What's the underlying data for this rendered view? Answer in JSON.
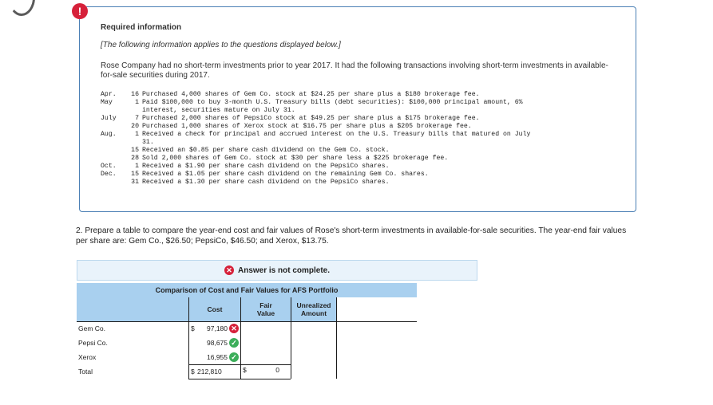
{
  "alert_glyph": "!",
  "info": {
    "title": "Required information",
    "subtitle": "[The following information applies to the questions displayed below.]",
    "intro": "Rose Company had no short-term investments prior to year 2017. It had the following transactions involving short-term investments in available-for-sale securities during 2017.",
    "transactions": [
      {
        "month": "Apr.",
        "day": "16",
        "text": "Purchased 4,000 shares of Gem Co. stock at $24.25 per share plus a $180 brokerage fee."
      },
      {
        "month": "May",
        "day": "1",
        "text": "Paid $100,000 to buy 3-month U.S. Treasury bills (debt securities): $100,000 principal amount, 6%\ninterest, securities mature on July 31."
      },
      {
        "month": "July",
        "day": "7",
        "text": "Purchased 2,000 shares of PepsiCo stock at $49.25 per share plus a $175 brokerage fee."
      },
      {
        "month": "",
        "day": "20",
        "text": "Purchased 1,000 shares of Xerox stock at $16.75 per share plus a $205 brokerage fee."
      },
      {
        "month": "Aug.",
        "day": "1",
        "text": "Received a check for principal and accrued interest on the U.S. Treasury bills that matured on July\n31."
      },
      {
        "month": "",
        "day": "15",
        "text": "Received an $0.85 per share cash dividend on the Gem Co. stock."
      },
      {
        "month": "",
        "day": "28",
        "text": "Sold 2,000 shares of Gem Co. stock at $30 per share less a $225 brokerage fee."
      },
      {
        "month": "Oct.",
        "day": "1",
        "text": "Received a $1.90 per share cash dividend on the PepsiCo shares."
      },
      {
        "month": "Dec.",
        "day": "15",
        "text": "Received a $1.05 per share cash dividend on the remaining Gem Co. shares."
      },
      {
        "month": "",
        "day": "31",
        "text": "Received a $1.30 per share cash dividend on the PepsiCo shares."
      }
    ]
  },
  "question": "2. Prepare a table to compare the year-end cost and fair values of Rose's short-term investments in available-for-sale securities. The year-end fair values per share are: Gem Co., $26.50; PepsiCo, $46.50; and Xerox, $13.75.",
  "answer_banner": {
    "text": "Answer is not complete.",
    "x_glyph": "✕"
  },
  "table": {
    "title": "Comparison of Cost and Fair Values for AFS Portfolio",
    "col_cost": "Cost",
    "col_fair": "Fair\nValue",
    "col_unrealized": "Unrealized\nAmount",
    "rows": [
      {
        "label": "Gem Co.",
        "cost_prefix": "$",
        "cost": "97,180",
        "status": "incorrect"
      },
      {
        "label": "Pepsi Co.",
        "cost_prefix": "",
        "cost": "98,675",
        "status": "correct"
      },
      {
        "label": "Xerox",
        "cost_prefix": "",
        "cost": "16,955",
        "status": "correct"
      }
    ],
    "total": {
      "label": "Total",
      "cost_prefix": "$",
      "cost": "212,810",
      "fair_prefix": "$",
      "fair": "0"
    },
    "incorrect_glyph": "✕",
    "correct_glyph": "✓"
  },
  "colors": {
    "accent_border": "#4b80b5",
    "header_fill": "#a9d0ef",
    "banner_fill": "#e9f3fb",
    "error": "#d6213a",
    "success": "#3cae5a"
  }
}
